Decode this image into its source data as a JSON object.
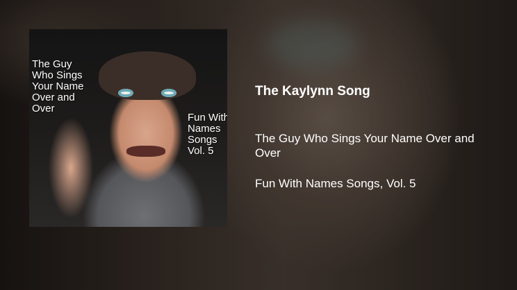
{
  "song": {
    "title": "The Kaylynn Song",
    "artist": "The Guy Who Sings Your Name Over and Over",
    "album": "Fun With Names Songs, Vol. 5"
  },
  "cover": {
    "artist_lines": [
      "The Guy",
      "Who Sings",
      "Your Name",
      "Over and",
      "Over"
    ],
    "album_lines": [
      "Fun With",
      "Names",
      "Songs",
      "Vol. 5"
    ]
  }
}
